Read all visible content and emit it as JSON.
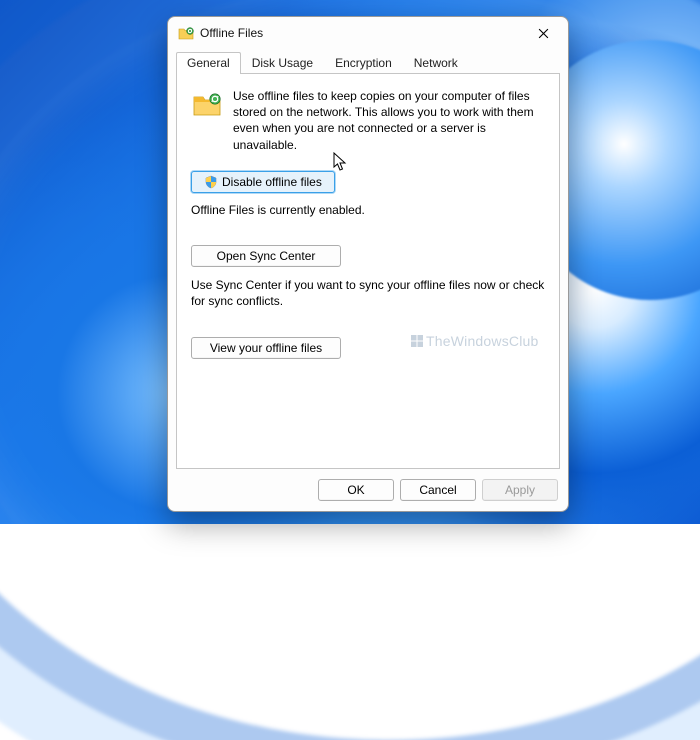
{
  "window": {
    "title": "Offline Files"
  },
  "tabs": {
    "general": "General",
    "disk": "Disk Usage",
    "encryption": "Encryption",
    "network": "Network"
  },
  "general": {
    "description": "Use offline files to keep copies on your computer of files stored on the network.  This allows you to work with them even when you are not connected or a server is unavailable.",
    "disable_button": "Disable offline files",
    "status": "Offline Files is currently enabled.",
    "open_sync_center": "Open Sync Center",
    "sync_help": "Use Sync Center if you want to sync your offline files now or check for sync conflicts.",
    "view_files": "View your offline files"
  },
  "footer": {
    "ok": "OK",
    "cancel": "Cancel",
    "apply": "Apply"
  },
  "watermark": "TheWindowsClub"
}
